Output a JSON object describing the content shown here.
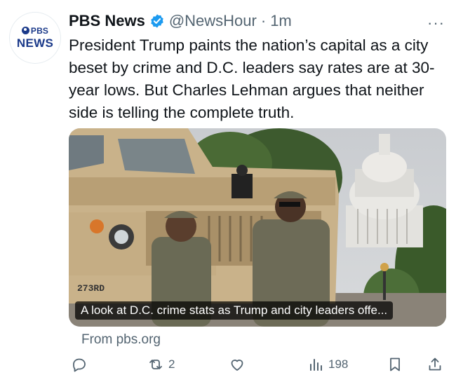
{
  "tweet": {
    "avatar": {
      "line1": "PBS",
      "line2": "NEWS"
    },
    "author_name": "PBS News",
    "handle": "@NewsHour",
    "separator": "·",
    "time": "1m",
    "more": "···",
    "text": "President Trump paints the nation’s capital as a city beset by crime and D.C. leaders say rates are at 30-year lows. But Charles Lehman argues that neither side is telling the complete truth."
  },
  "card": {
    "vehicle_marking": "273RD",
    "caption": "A look at D.C. crime stats as Trump and city leaders offe...",
    "source": "From pbs.org"
  },
  "actions": {
    "reply_icon": "reply-icon",
    "repost_icon": "repost-icon",
    "repost_count": "2",
    "like_icon": "heart-icon",
    "views_icon": "views-icon",
    "views_count": "198",
    "bookmark_icon": "bookmark-icon",
    "share_icon": "share-icon"
  },
  "colors": {
    "verified": "#1d9bf0",
    "muted": "#536471",
    "pbs_blue": "#1b3a8a"
  }
}
